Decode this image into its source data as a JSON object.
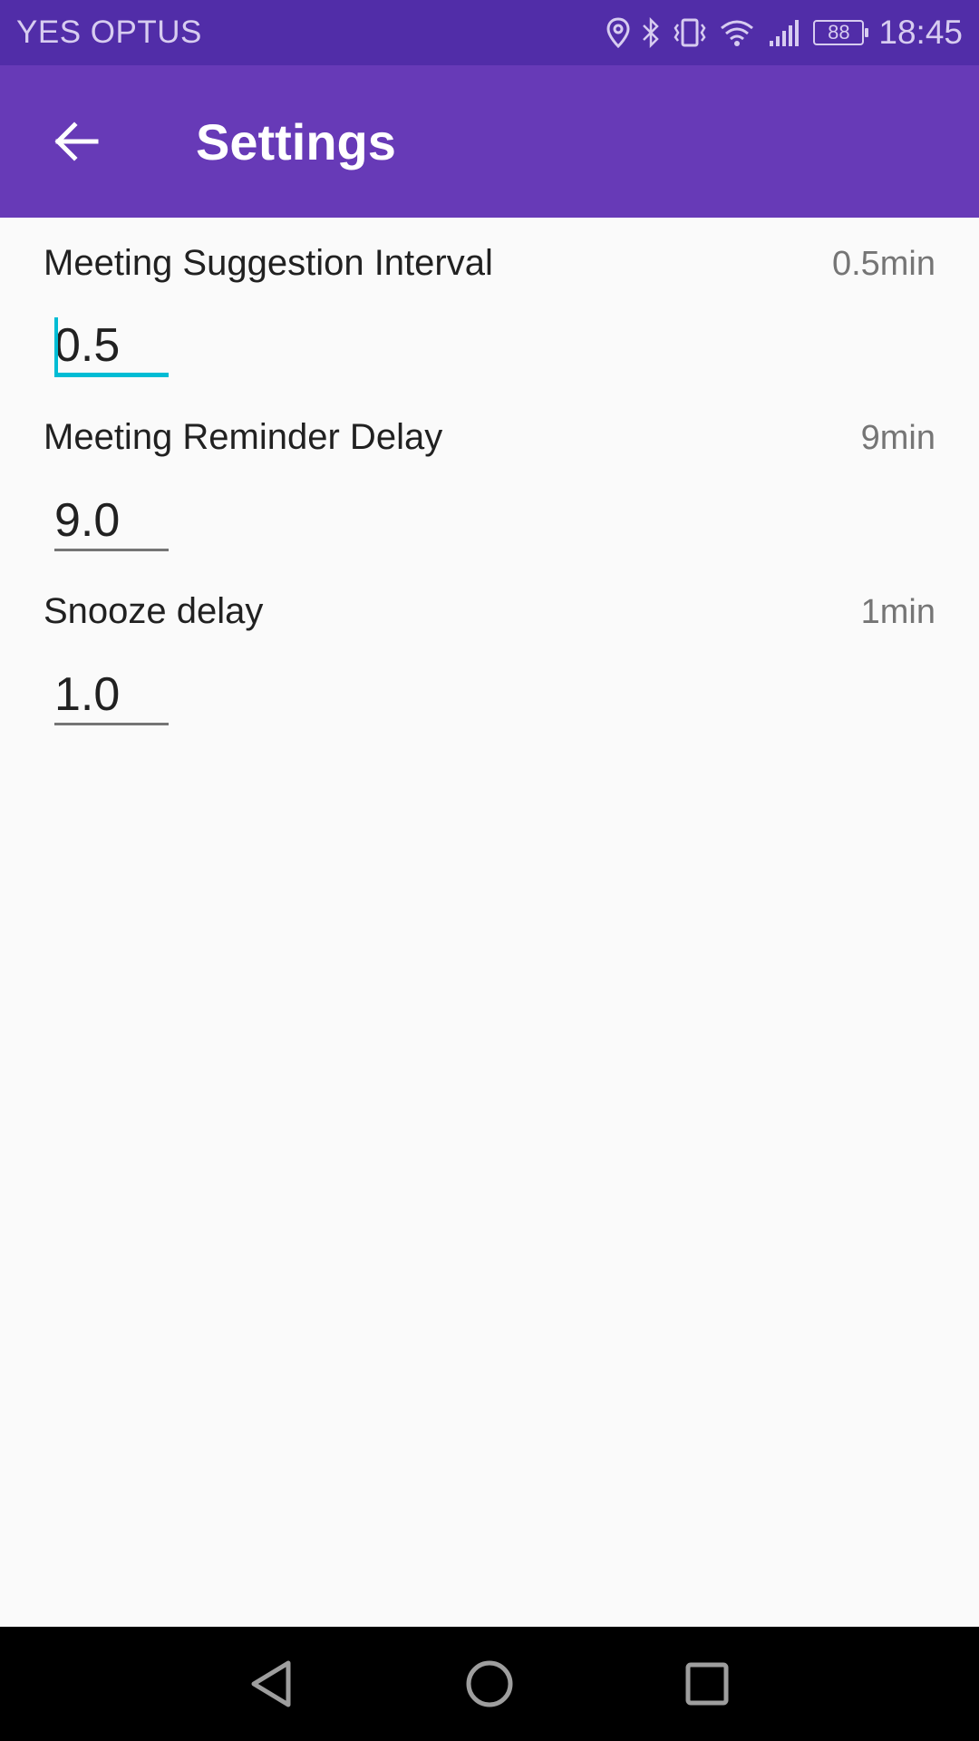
{
  "status_bar": {
    "carrier": "YES OPTUS",
    "battery_level": "88",
    "time": "18:45",
    "icons": [
      "location-icon",
      "bluetooth-icon",
      "vibrate-icon",
      "wifi-icon",
      "signal-icon",
      "battery-icon"
    ]
  },
  "app_bar": {
    "title": "Settings",
    "back_icon": "arrow-back-icon"
  },
  "settings": [
    {
      "title": "Meeting Suggestion Interval",
      "summary": "0.5min",
      "value": "0.5",
      "focused": true
    },
    {
      "title": "Meeting Reminder Delay",
      "summary": "9min",
      "value": "9.0",
      "focused": false
    },
    {
      "title": "Snooze delay",
      "summary": "1min",
      "value": "1.0",
      "focused": false
    }
  ],
  "nav_bar": {
    "buttons": [
      "back-triangle-icon",
      "home-circle-icon",
      "recents-square-icon"
    ]
  },
  "colors": {
    "status_bar": "#512da8",
    "app_bar": "#673ab7",
    "accent": "#00bcd4",
    "background": "#fafafa"
  }
}
